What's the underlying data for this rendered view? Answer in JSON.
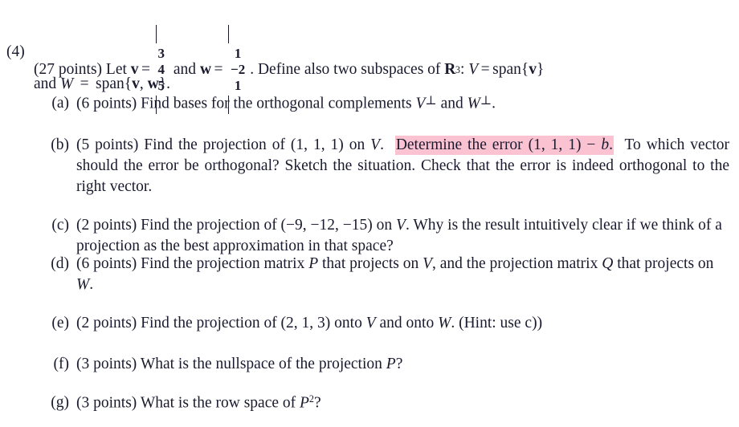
{
  "document": {
    "type": "math-exam-problem",
    "highlight_color": "#fbc3d2",
    "text_color": "#1a1a2e",
    "background_color": "#ffffff"
  },
  "problem": {
    "number": "(4)",
    "points": "(27 points)",
    "stem": {
      "lead": "Let",
      "v_symbol": "v",
      "equals": "=",
      "v_entries": [
        "3",
        "4",
        "5"
      ],
      "and": "and",
      "w_symbol": "w",
      "w_entries": [
        "1",
        "-2",
        "1"
      ],
      "after_vectors": ". Define also two subspaces of",
      "field_symbol": "R",
      "field_exponent": "3",
      "colon": ":",
      "V_symbol": "V",
      "span_v": "span{v}",
      "continuation": "and W = span{v, w}."
    }
  },
  "parts": [
    {
      "tag": "(a)",
      "points": "(6 points)",
      "text": "Find bases for the orthogonal complements V⊥ and W⊥."
    },
    {
      "tag": "(b)",
      "points": "(5 points)",
      "segments": [
        {
          "kind": "plain",
          "text": "Find the projection of (1, 1, 1) on V. "
        },
        {
          "kind": "highlight",
          "text": "Determine the error (1, 1, 1) − b."
        },
        {
          "kind": "plain",
          "text": " To which vector should the error be orthogonal? Sketch the situation. Check that the error is indeed orthogonal to the right vector."
        }
      ]
    },
    {
      "tag": "(c)",
      "points": "(2 points)",
      "text": "Find the projection of (−9, −12, −15) on V. Why is the result intuitively clear if we think of a projection as the best approximation in that space?"
    },
    {
      "tag": "(d)",
      "points": "(6 points)",
      "text": "Find the projection matrix P that projects on V, and the projection matrix Q that projects on W."
    },
    {
      "tag": "(e)",
      "points": "(2 points)",
      "text": "Find the projection of (2, 1, 3) onto V and onto W. (Hint: use c))"
    },
    {
      "tag": "(f)",
      "points": "(3 points)",
      "text": "What is the nullspace of the projection P?"
    },
    {
      "tag": "(g)",
      "points": "(3 points)",
      "text": "What is the row space of P²?"
    }
  ]
}
